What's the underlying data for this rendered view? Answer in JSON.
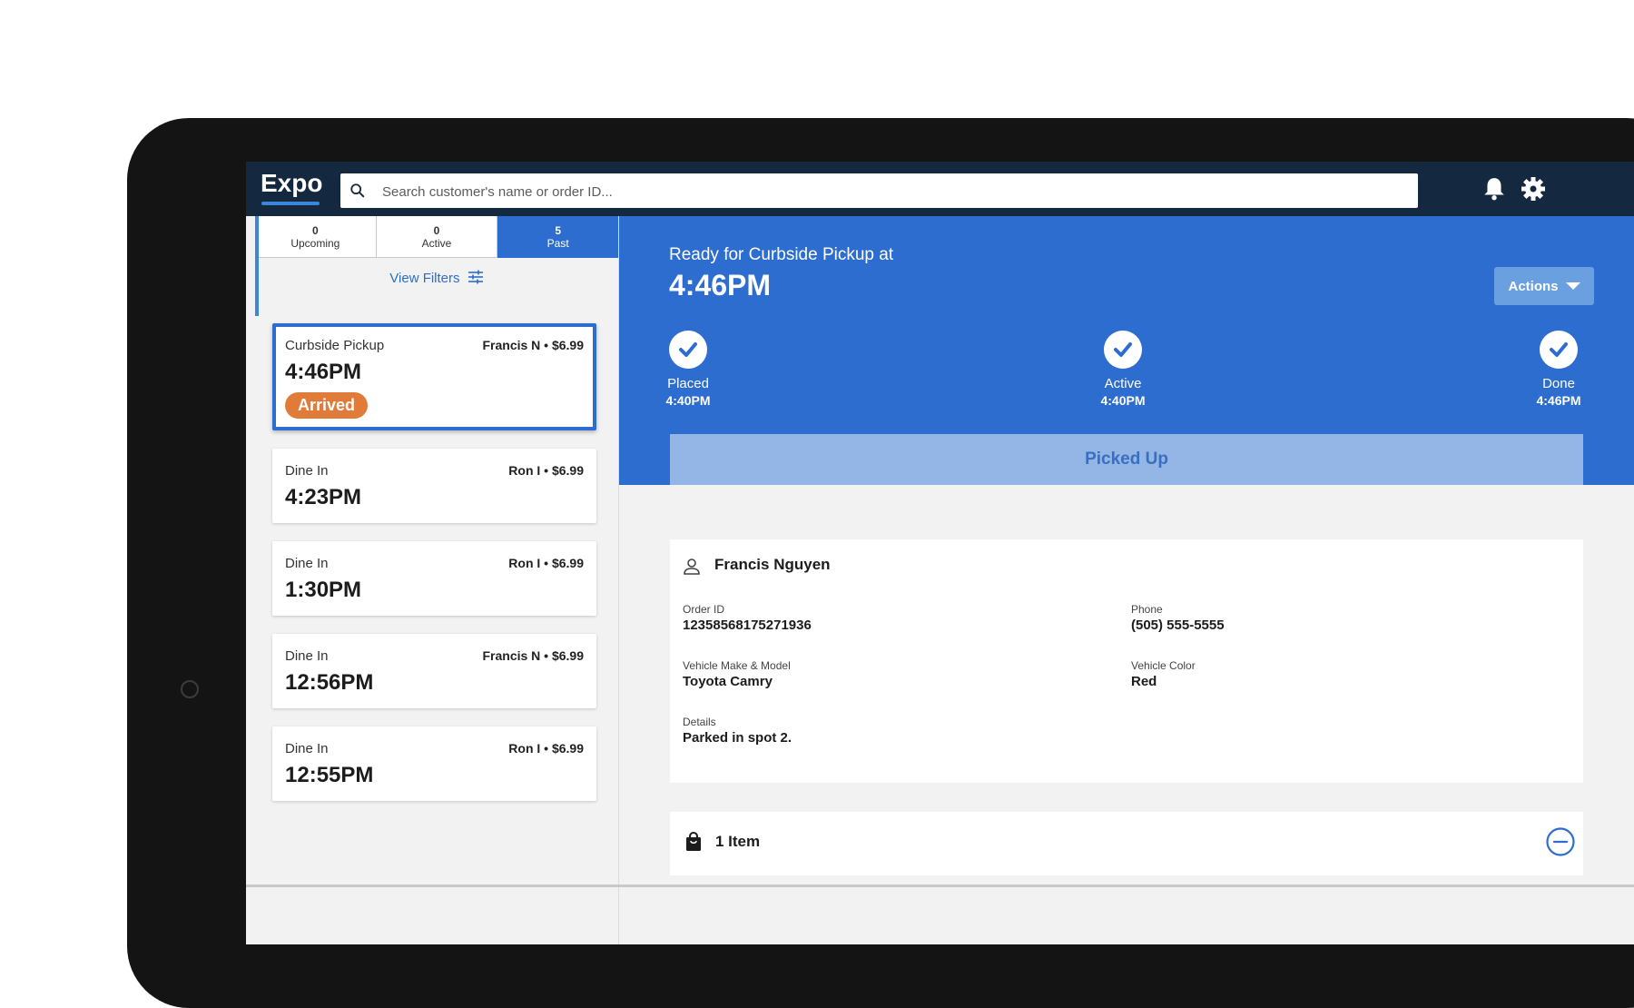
{
  "app": {
    "title": "Expo"
  },
  "search": {
    "placeholder": "Search customer's name or order ID..."
  },
  "icons": {
    "search": "search-icon",
    "bell": "bell-icon",
    "settings": "gear-icon"
  },
  "colors": {
    "primary": "#2c6dcf",
    "topbar": "#14283f",
    "badge": "#e07b39"
  },
  "tabs": [
    {
      "count": "0",
      "label": "Upcoming",
      "active": false
    },
    {
      "count": "0",
      "label": "Active",
      "active": false
    },
    {
      "count": "5",
      "label": "Past",
      "active": true
    }
  ],
  "filters": {
    "label": "View Filters"
  },
  "orders": [
    {
      "type": "Curbside Pickup",
      "customer": "Francis N • $6.99",
      "time": "4:46PM",
      "badge": "Arrived",
      "selected": true
    },
    {
      "type": "Dine In",
      "customer": "Ron I • $6.99",
      "time": "4:23PM"
    },
    {
      "type": "Dine In",
      "customer": "Ron I • $6.99",
      "time": "1:30PM"
    },
    {
      "type": "Dine In",
      "customer": "Francis N • $6.99",
      "time": "12:56PM"
    },
    {
      "type": "Dine In",
      "customer": "Ron I • $6.99",
      "time": "12:55PM"
    }
  ],
  "detail": {
    "subtitle": "Ready for Curbside Pickup at",
    "time": "4:46PM",
    "actions_label": "Actions",
    "steps": [
      {
        "label": "Placed",
        "time": "4:40PM"
      },
      {
        "label": "Active",
        "time": "4:40PM"
      },
      {
        "label": "Done",
        "time": "4:46PM"
      }
    ],
    "primary_button": "Picked Up",
    "customer": {
      "name": "Francis Nguyen",
      "fields": [
        {
          "key": "Order ID",
          "value": "12358568175271936"
        },
        {
          "key": "Phone",
          "value": "(505) 555-5555"
        },
        {
          "key": "Vehicle Make & Model",
          "value": "Toyota Camry"
        },
        {
          "key": "Vehicle Color",
          "value": "Red"
        },
        {
          "key": "Details",
          "value": "Parked in spot 2."
        }
      ]
    },
    "items": {
      "label": "1 Item"
    }
  }
}
